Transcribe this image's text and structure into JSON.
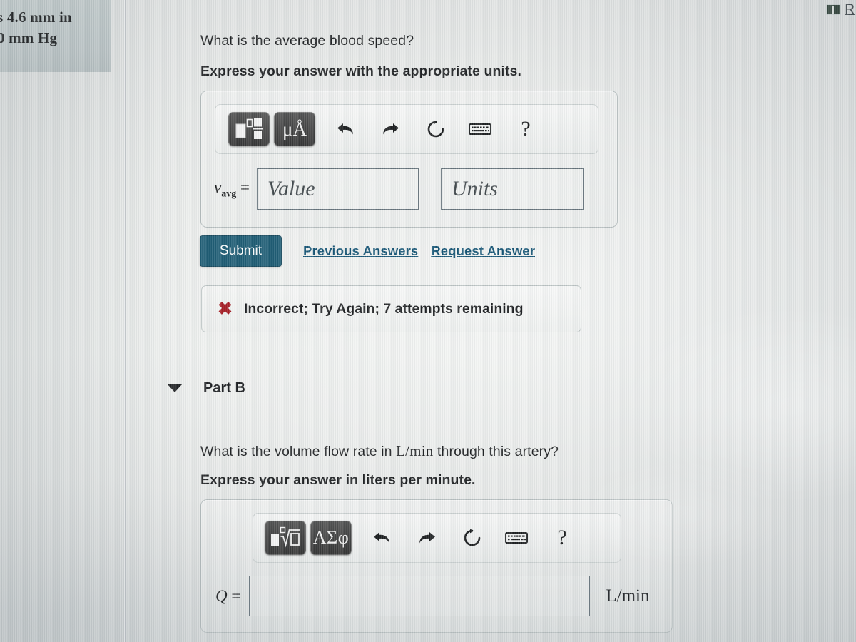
{
  "left_panel": {
    "line1": "s 4.6 mm in",
    "line2": "0 mm Hg"
  },
  "browser": {
    "reader_icon": "book-icon",
    "partial_label": "R"
  },
  "part_a": {
    "question": "What is the average blood speed?",
    "instruction": "Express your answer with the appropriate units.",
    "toolbar": {
      "template_button": "template-icon",
      "units_button": "μÅ",
      "undo": "undo-icon",
      "redo": "redo-icon",
      "reset": "reset-icon",
      "keyboard": "keyboard-icon",
      "help": "?"
    },
    "variable_label": "v",
    "variable_sub": "avg",
    "equals": "=",
    "value_placeholder": "Value",
    "units_placeholder": "Units",
    "value_text": "",
    "units_text": "",
    "submit_label": "Submit",
    "previous_answers_label": "Previous Answers",
    "request_answer_label": "Request Answer",
    "feedback_icon": "✖",
    "feedback_text": "Incorrect; Try Again; 7 attempts remaining",
    "feedback_color": "#a4161d"
  },
  "part_b": {
    "header_label": "Part B",
    "caret": "chevron-down-icon",
    "question_pre": "What is the volume flow rate in ",
    "question_math": "L/min",
    "question_post": " through this artery?",
    "instruction": "Express your answer in liters per minute.",
    "toolbar": {
      "template_button": "root-template-icon",
      "greek_button": "ΑΣφ",
      "undo": "undo-icon",
      "redo": "redo-icon",
      "reset": "reset-icon",
      "keyboard": "keyboard-icon",
      "help": "?"
    },
    "variable_label": "Q",
    "equals": "=",
    "answer_text": "",
    "unit_label": "L/min"
  },
  "colors": {
    "submit_bg": "#15566f",
    "link": "#0d4f70",
    "error": "#a4161d",
    "toolbar_button": "#3b3b3b"
  }
}
